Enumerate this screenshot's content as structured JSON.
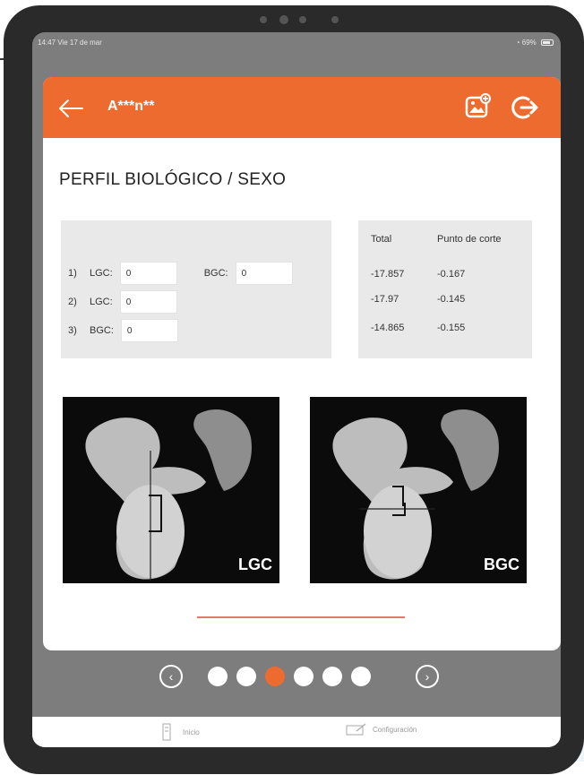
{
  "status_bar": {
    "time_date": "14:47  Vie 17 de mar",
    "battery": "69%"
  },
  "app_bar": {
    "user_name": "A***n**"
  },
  "page": {
    "title": "PERFIL BIOLÓGICO / SEXO"
  },
  "inputs": {
    "rows": [
      {
        "num": "1)",
        "label1": "LGC:",
        "value1": "0",
        "label2": "BGC:",
        "value2": "0"
      },
      {
        "num": "2)",
        "label1": "LGC:",
        "value1": "0"
      },
      {
        "num": "3)",
        "label1": "BGC:",
        "value1": "0"
      }
    ]
  },
  "results": {
    "header_total": "Total",
    "header_cut": "Punto de corte",
    "rows": [
      {
        "total": "-17.857",
        "cut": "-0.167"
      },
      {
        "total": "-17.97",
        "cut": "-0.145"
      },
      {
        "total": "-14.865",
        "cut": "-0.155"
      }
    ]
  },
  "images": [
    {
      "label": "LGC"
    },
    {
      "label": "BGC"
    }
  ],
  "pager": {
    "page_count": 6,
    "active_index": 2
  },
  "tabs": [
    {
      "label": "Inicio",
      "icon": "home-icon"
    },
    {
      "label": "Configuración",
      "icon": "settings-icon"
    }
  ],
  "colors": {
    "accent": "#ee6b2f",
    "screen_bg": "#7d7d7d",
    "panel_bg": "#e9e9e9"
  }
}
